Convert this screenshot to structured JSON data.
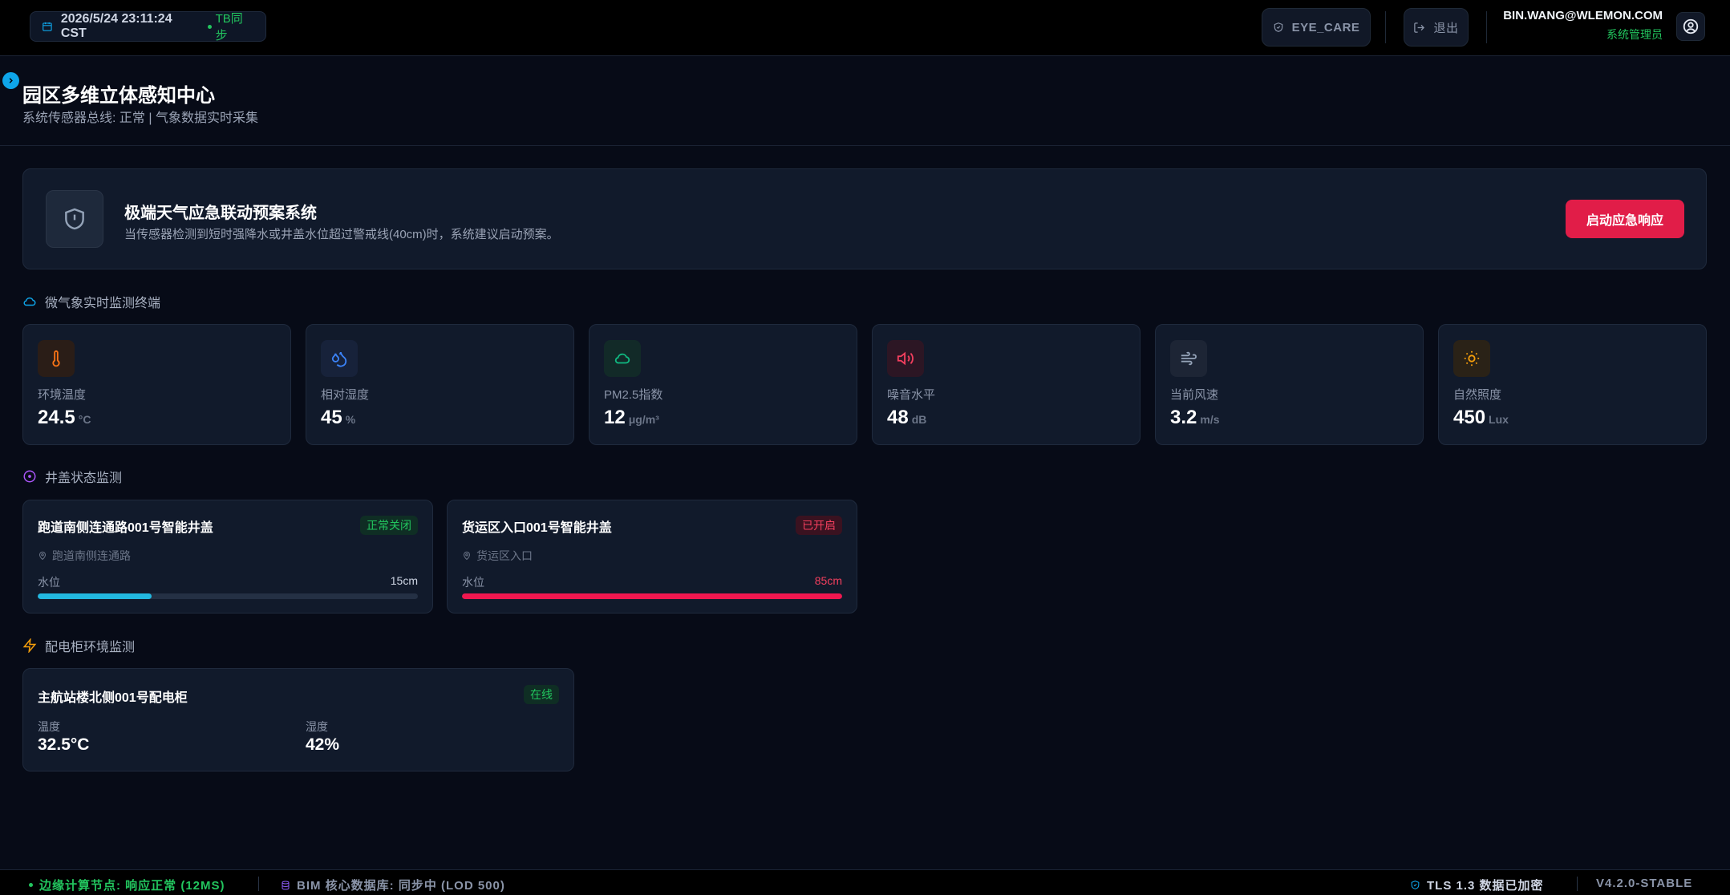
{
  "topbar": {
    "datetime": "2026/5/24 23:11:24 CST",
    "sync_label": "TB同步",
    "eye_care_label": "EYE_CARE",
    "logout_label": "退出",
    "user_email": "BIN.WANG@WLEMON.COM",
    "user_role": "系统管理员"
  },
  "header": {
    "title": "园区多维立体感知中心",
    "subtitle": "系统传感器总线: 正常 | 气象数据实时采集"
  },
  "alert": {
    "title": "极端天气应急联动预案系统",
    "description": "当传感器检测到短时强降水或井盖水位超过警戒线(40cm)时，系统建议启动预案。",
    "button_label": "启动应急响应"
  },
  "weather": {
    "section_title": "微气象实时监测终端",
    "metrics": [
      {
        "label": "环境温度",
        "value": "24.5",
        "unit": "°C",
        "icon": "thermometer-icon",
        "color": "#f97316"
      },
      {
        "label": "相对湿度",
        "value": "45",
        "unit": "%",
        "icon": "droplets-icon",
        "color": "#3b82f6"
      },
      {
        "label": "PM2.5指数",
        "value": "12",
        "unit": "μg/m³",
        "icon": "cloud-icon",
        "color": "#10b981"
      },
      {
        "label": "噪音水平",
        "value": "48",
        "unit": "dB",
        "icon": "volume-icon",
        "color": "#f43f5e"
      },
      {
        "label": "当前风速",
        "value": "3.2",
        "unit": "m/s",
        "icon": "wind-icon",
        "color": "#94a3b8"
      },
      {
        "label": "自然照度",
        "value": "450",
        "unit": "Lux",
        "icon": "sun-icon",
        "color": "#f59e0b"
      }
    ]
  },
  "manholes": {
    "section_title": "井盖状态监测",
    "water_level_label": "水位",
    "items": [
      {
        "name": "跑道南侧连通路001号智能井盖",
        "status": "正常关闭",
        "location": "跑道南侧连通路",
        "level": "15cm",
        "level_fraction": 0.3
      },
      {
        "name": "货运区入口001号智能井盖",
        "status": "已开启",
        "location": "货运区入口",
        "level": "85cm",
        "level_fraction": 1.0
      }
    ]
  },
  "cabinets": {
    "section_title": "配电柜环境监测",
    "items": [
      {
        "name": "主航站楼北侧001号配电柜",
        "status": "在线",
        "temp_label": "温度",
        "temp_value": "32.5°C",
        "humidity_label": "湿度",
        "humidity_value": "42%"
      }
    ]
  },
  "statusbar": {
    "edge_node": "边缘计算节点: 响应正常 (12MS)",
    "bim_db": "BIM 核心数据库: 同步中 (LOD 500)",
    "tls": "TLS 1.3 数据已加密",
    "version": "V4.2.0-STABLE"
  },
  "colors": {
    "accent": "#0ea5e9",
    "danger": "#e11d48",
    "success": "#22c55e",
    "water_ok": "#22b8e0",
    "water_bad": "#f0174f"
  }
}
